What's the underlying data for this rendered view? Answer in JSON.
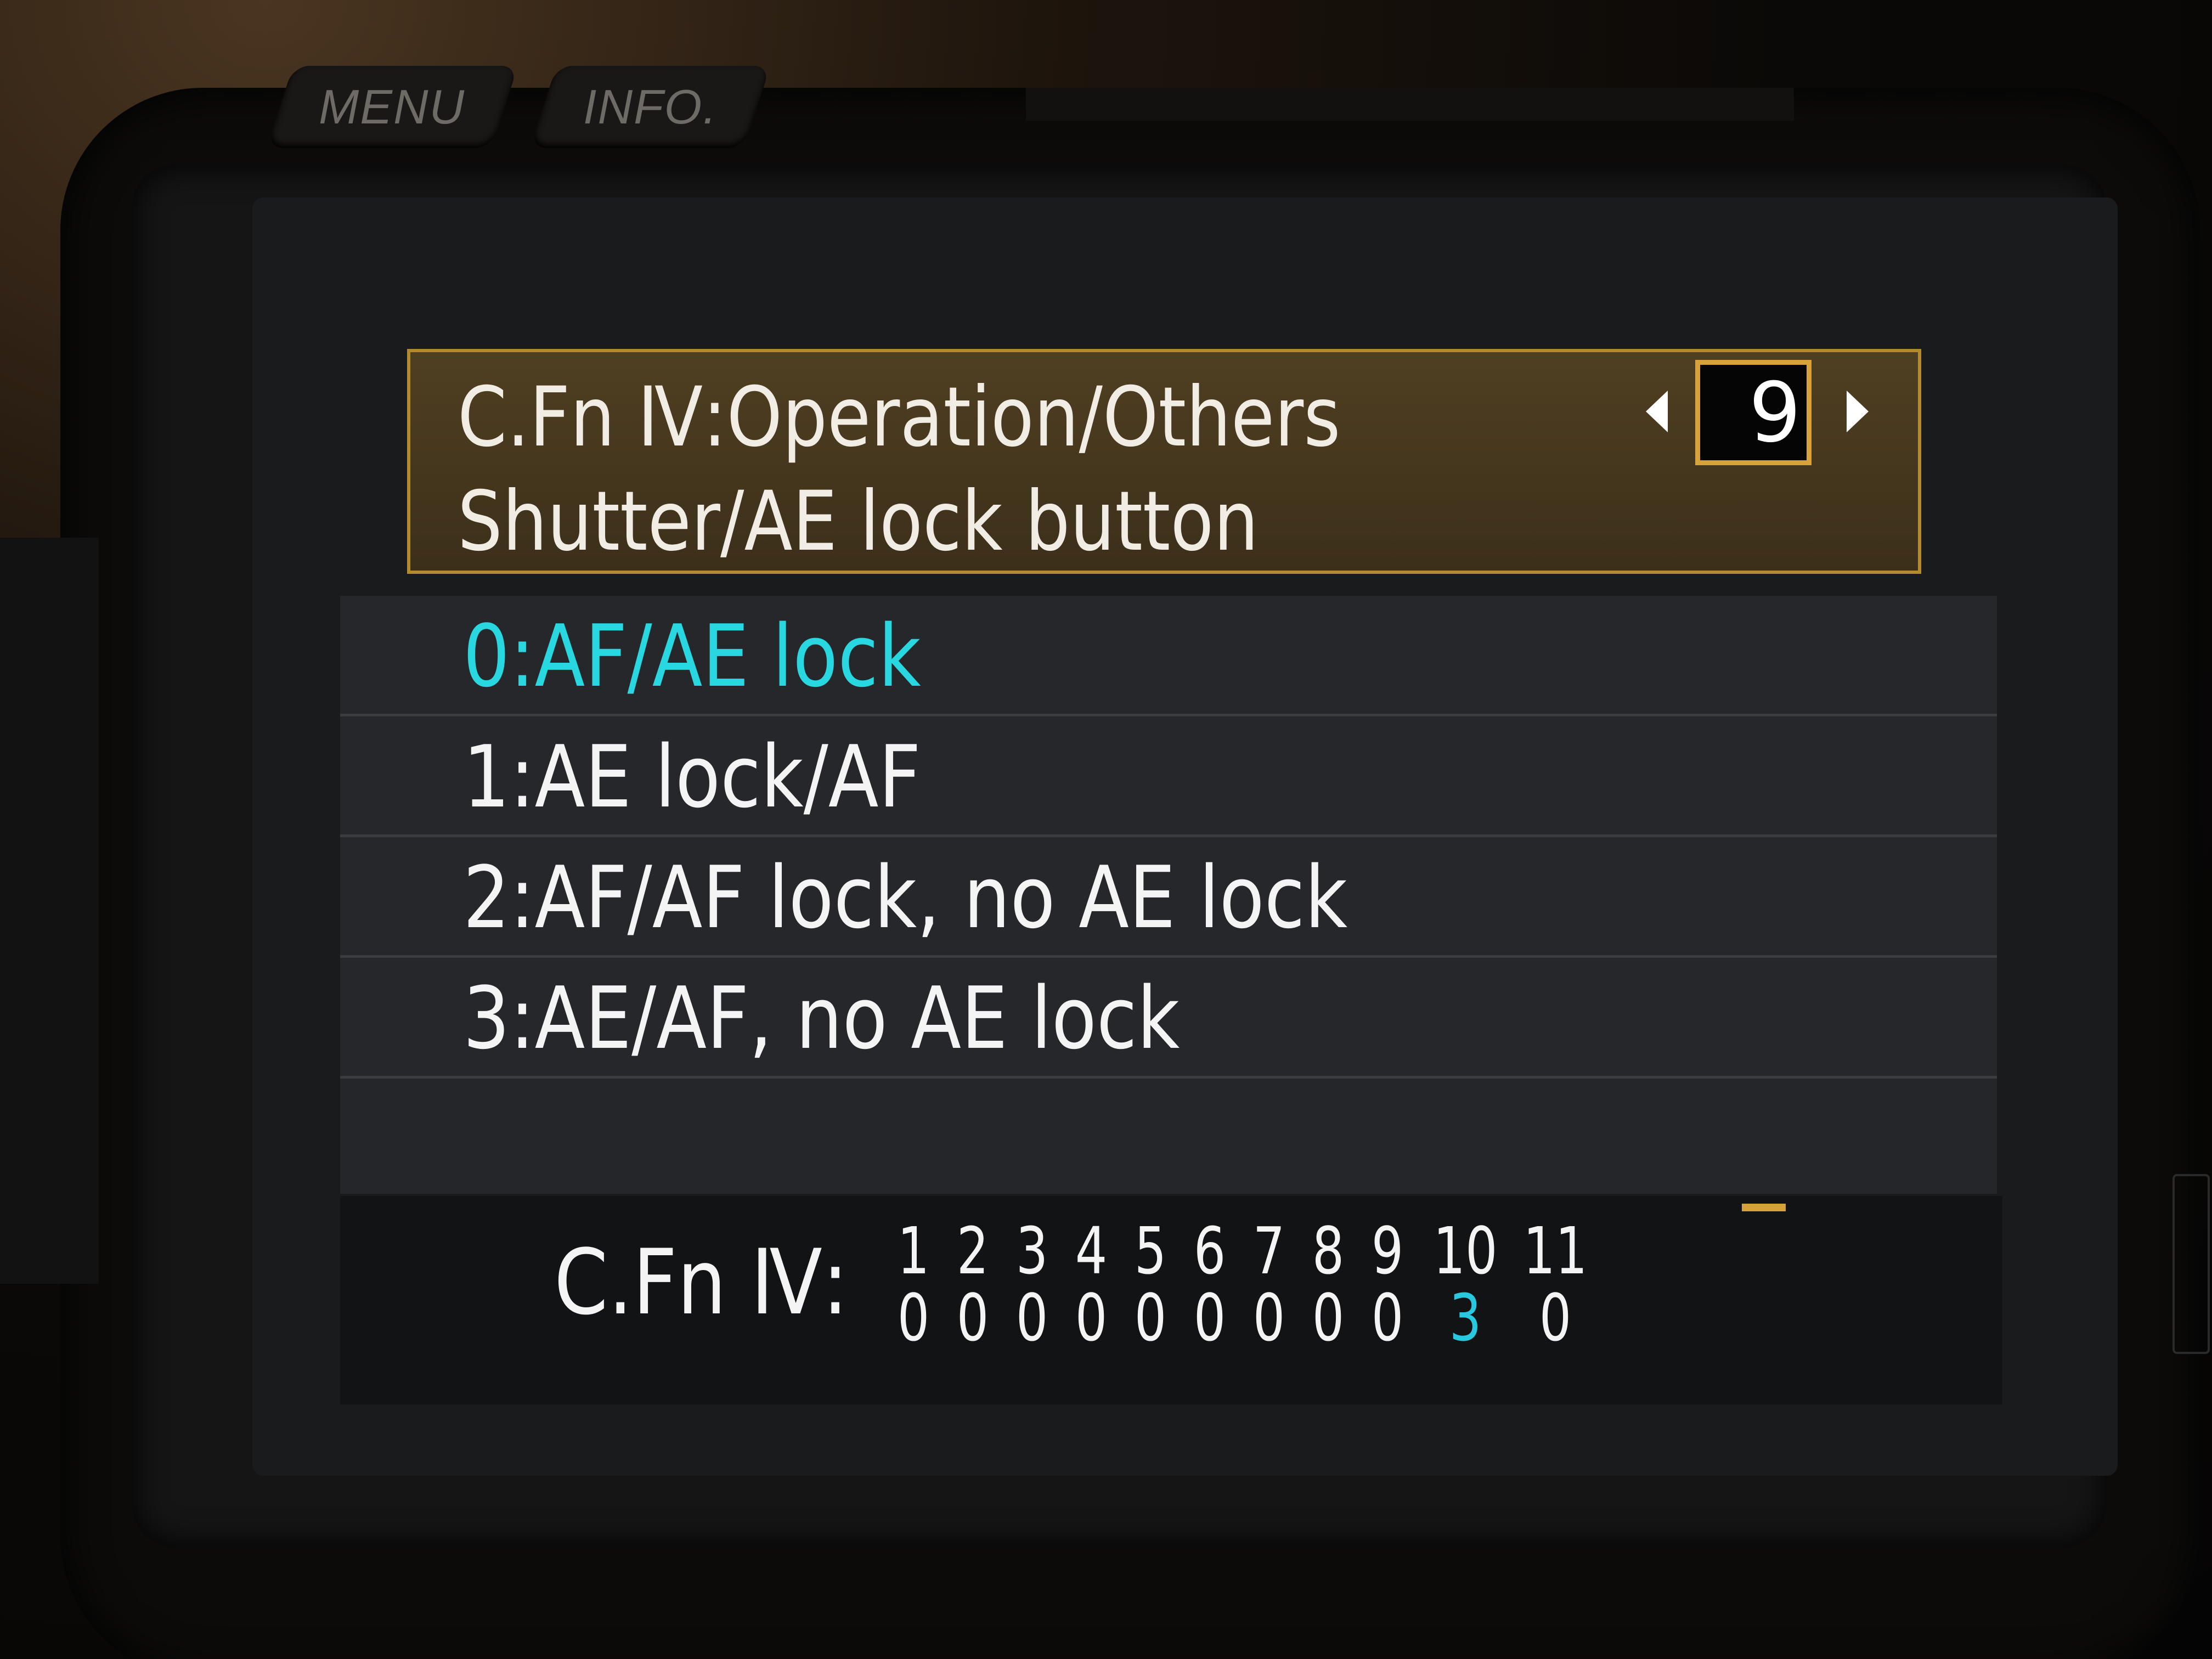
{
  "hardware": {
    "menu_label": "MENU",
    "info_label": "INFO."
  },
  "header": {
    "title": "C.Fn Ⅳ:Operation/Others",
    "subtitle": "Shutter/AE lock button",
    "number": "9"
  },
  "options": [
    {
      "label": "0:AF/AE lock",
      "selected": true
    },
    {
      "label": "1:AE lock/AF",
      "selected": false
    },
    {
      "label": "2:AF/AF lock, no AE lock",
      "selected": false
    },
    {
      "label": "3:AE/AF, no AE lock",
      "selected": false
    }
  ],
  "status": {
    "label": "C.Fn Ⅳ:",
    "functions": [
      {
        "num": "1",
        "val": "0"
      },
      {
        "num": "2",
        "val": "0"
      },
      {
        "num": "3",
        "val": "0"
      },
      {
        "num": "4",
        "val": "0"
      },
      {
        "num": "5",
        "val": "0"
      },
      {
        "num": "6",
        "val": "0"
      },
      {
        "num": "7",
        "val": "0"
      },
      {
        "num": "8",
        "val": "0"
      },
      {
        "num": "9",
        "val": "0"
      },
      {
        "num": "10",
        "val": "3"
      },
      {
        "num": "11",
        "val": "0"
      }
    ]
  },
  "colors": {
    "selected_text": "#28d7e0",
    "highlight_border": "#d8a23b",
    "changed_value": "#28c9df"
  }
}
